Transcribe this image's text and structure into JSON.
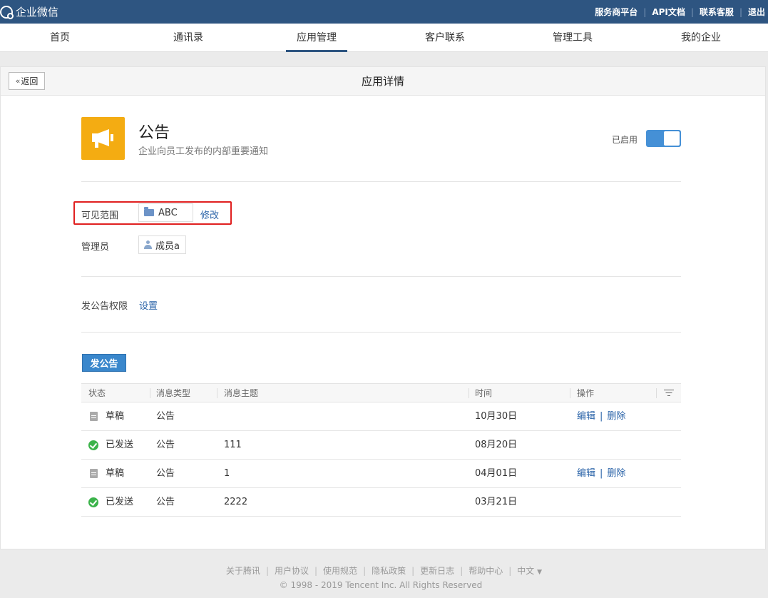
{
  "header": {
    "brand": "企业微信",
    "links": [
      "服务商平台",
      "API文档",
      "联系客服",
      "退出"
    ]
  },
  "nav": {
    "items": [
      "首页",
      "通讯录",
      "应用管理",
      "客户联系",
      "管理工具",
      "我的企业"
    ],
    "active": "应用管理"
  },
  "page": {
    "back_label": "返回",
    "title": "应用详情"
  },
  "app": {
    "icon": "megaphone-icon",
    "icon_color": "#f4ac12",
    "name": "公告",
    "description": "企业向员工发布的内部重要通知",
    "status_label": "已启用",
    "enabled": true
  },
  "visibility": {
    "label": "可见范围",
    "scope_value": "ABC",
    "edit_label": "修改"
  },
  "admin": {
    "label": "管理员",
    "member": "成员a"
  },
  "permission": {
    "label": "发公告权限",
    "set_label": "设置"
  },
  "actions": {
    "post_label": "发公告"
  },
  "table": {
    "headers": [
      "状态",
      "消息类型",
      "消息主题",
      "时间",
      "操作"
    ],
    "rows": [
      {
        "status": "草稿",
        "status_type": "draft",
        "type": "公告",
        "subject": "",
        "time": "10月30日",
        "edit": "编辑",
        "delete": "删除"
      },
      {
        "status": "已发送",
        "status_type": "sent",
        "type": "公告",
        "subject": "111",
        "time": "08月20日",
        "edit": "",
        "delete": ""
      },
      {
        "status": "草稿",
        "status_type": "draft",
        "type": "公告",
        "subject": "1",
        "time": "04月01日",
        "edit": "编辑",
        "delete": "删除"
      },
      {
        "status": "已发送",
        "status_type": "sent",
        "type": "公告",
        "subject": "2222",
        "time": "03月21日",
        "edit": "",
        "delete": ""
      }
    ]
  },
  "footer": {
    "links": [
      "关于腾讯",
      "用户协议",
      "使用规范",
      "隐私政策",
      "更新日志",
      "帮助中心"
    ],
    "language": "中文",
    "copyright": "© 1998 - 2019 Tencent Inc. All Rights Reserved"
  },
  "colors": {
    "topbar": "#2e5581",
    "primary": "#3a87cc",
    "link": "#2a63a8",
    "highlight": "#e02020",
    "success": "#3bb34a"
  }
}
